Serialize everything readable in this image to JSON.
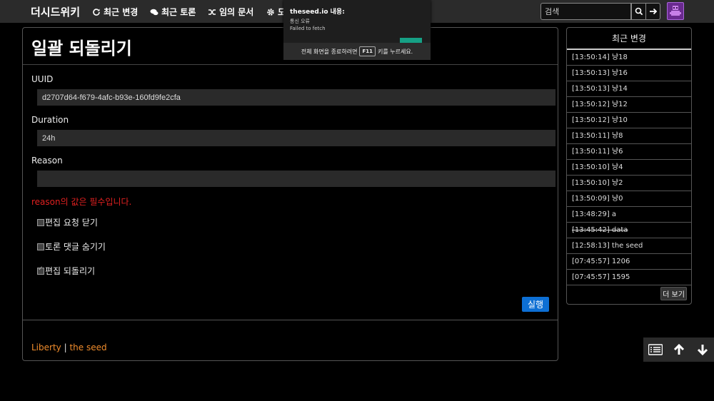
{
  "app": {
    "brand": "더시드위키",
    "nav": [
      {
        "label": "최근 변경",
        "icon": "refresh-icon"
      },
      {
        "label": "최근 토론",
        "icon": "comments-icon"
      },
      {
        "label": "임의 문서",
        "icon": "random-icon"
      },
      {
        "label": "도",
        "icon": "gear-icon"
      }
    ],
    "search_placeholder": "검색"
  },
  "alert": {
    "title": "theseed.io 내용:",
    "line1": "통신 오류",
    "line2": "Failed to fetch",
    "fullscreen_before": "전체 화면을 종료하려면",
    "fullscreen_key": "F11",
    "fullscreen_after": "키를 누르세요."
  },
  "main": {
    "title": "일괄 되돌리기",
    "uuid_label": "UUID",
    "uuid_value": "d2707d64-f679-4afc-b93e-160fd9fe2cfa",
    "duration_label": "Duration",
    "duration_value": "24h",
    "reason_label": "Reason",
    "reason_value": "",
    "error": "reason의 값은 필수입니다.",
    "checks": [
      {
        "label": "편집 요청 닫기",
        "checked": false
      },
      {
        "label": "토론 댓글 숨기기",
        "checked": false
      },
      {
        "label": "편집 되돌리기",
        "checked": true
      }
    ],
    "run_label": "실행",
    "footer_link1": "Liberty",
    "footer_sep": "|",
    "footer_link2": "the seed"
  },
  "sidebar": {
    "title": "최근 변경",
    "items": [
      {
        "text": "[13:50:14] 냥18",
        "struck": false
      },
      {
        "text": "[13:50:13] 냥16",
        "struck": false
      },
      {
        "text": "[13:50:13] 냥14",
        "struck": false
      },
      {
        "text": "[13:50:12] 냥12",
        "struck": false
      },
      {
        "text": "[13:50:12] 냥10",
        "struck": false
      },
      {
        "text": "[13:50:11] 냥8",
        "struck": false
      },
      {
        "text": "[13:50:11] 냥6",
        "struck": false
      },
      {
        "text": "[13:50:10] 냥4",
        "struck": false
      },
      {
        "text": "[13:50:10] 냥2",
        "struck": false
      },
      {
        "text": "[13:50:09] 냥0",
        "struck": false
      },
      {
        "text": "[13:48:29] a",
        "struck": false
      },
      {
        "text": "[13:45:42] data",
        "struck": true
      },
      {
        "text": "[12:58:13] the seed",
        "struck": false
      },
      {
        "text": "[07:45:57] 1206",
        "struck": false
      },
      {
        "text": "[07:45:57] 1595",
        "struck": false
      }
    ],
    "more_label": "더 보기"
  },
  "colors": {
    "accent": "#0d6fd4",
    "error": "#e02020",
    "footer_link": "#f08c2c",
    "topbar": "#2b2b2b"
  }
}
